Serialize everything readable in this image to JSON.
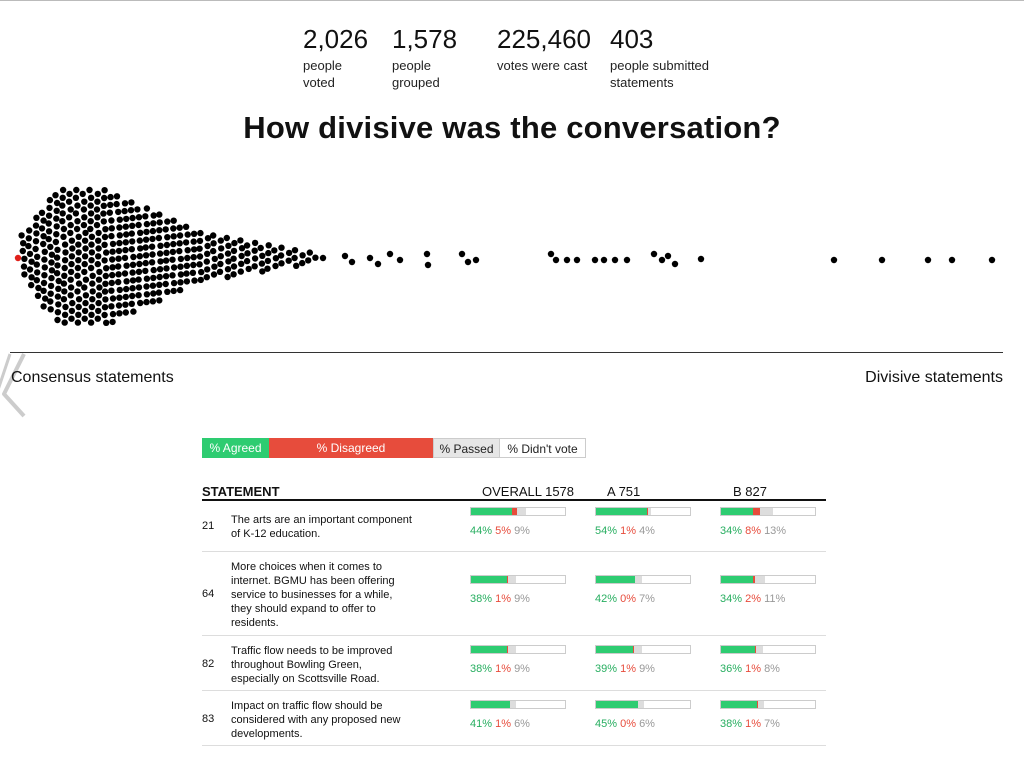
{
  "stats": [
    {
      "number": "2,026",
      "label_lines": [
        "people",
        "voted"
      ]
    },
    {
      "number": "1,578",
      "label_lines": [
        "people",
        "grouped"
      ]
    },
    {
      "number": "225,460",
      "label_lines": [
        "votes were cast",
        ""
      ]
    },
    {
      "number": "403",
      "label_lines": [
        "people submitted",
        "statements"
      ]
    }
  ],
  "title": "How divisive was the conversation?",
  "axis": {
    "left_label": "Consensus statements",
    "right_label": "Divisive statements"
  },
  "legend": {
    "agreed": "% Agreed",
    "disagreed": "% Disagreed",
    "passed": "% Passed",
    "didnt_vote": "% Didn't vote"
  },
  "colors": {
    "agree": "#2ecc71",
    "disagree": "#e74c3c",
    "pass": "#dddddd",
    "dot": "#000000",
    "highlight_dot": "#e0201a"
  },
  "table": {
    "headers": {
      "statement": "STATEMENT",
      "overall": "OVERALL 1578",
      "group_a": "A 751",
      "group_b": "B 827"
    },
    "rows": [
      {
        "id": "21",
        "text_lines": [
          "The arts are an important component",
          "of K-12 education."
        ],
        "overall": {
          "a": 44,
          "d": 5,
          "p": 9,
          "a_label": "44%",
          "d_label": "5%",
          "p_label": "9%"
        },
        "group_a": {
          "a": 54,
          "d": 1,
          "p": 4,
          "a_label": "54%",
          "d_label": "1%",
          "p_label": "4%"
        },
        "group_b": {
          "a": 34,
          "d": 8,
          "p": 13,
          "a_label": "34%",
          "d_label": "8%",
          "p_label": "13%"
        }
      },
      {
        "id": "64",
        "text_lines": [
          "More choices when it comes to",
          "internet. BGMU has been offering",
          "service to businesses for a while,",
          "they should expand to offer to",
          "residents."
        ],
        "overall": {
          "a": 38,
          "d": 1,
          "p": 9,
          "a_label": "38%",
          "d_label": "1%",
          "p_label": "9%"
        },
        "group_a": {
          "a": 42,
          "d": 0,
          "p": 7,
          "a_label": "42%",
          "d_label": "0%",
          "p_label": "7%"
        },
        "group_b": {
          "a": 34,
          "d": 2,
          "p": 11,
          "a_label": "34%",
          "d_label": "2%",
          "p_label": "11%"
        }
      },
      {
        "id": "82",
        "text_lines": [
          "Traffic flow needs to be improved",
          "throughout Bowling Green,",
          "especially on Scottsville Road."
        ],
        "overall": {
          "a": 38,
          "d": 1,
          "p": 9,
          "a_label": "38%",
          "d_label": "1%",
          "p_label": "9%"
        },
        "group_a": {
          "a": 39,
          "d": 1,
          "p": 9,
          "a_label": "39%",
          "d_label": "1%",
          "p_label": "9%"
        },
        "group_b": {
          "a": 36,
          "d": 1,
          "p": 8,
          "a_label": "36%",
          "d_label": "1%",
          "p_label": "8%"
        }
      },
      {
        "id": "83",
        "text_lines": [
          "Impact on traffic flow should be",
          "considered with any proposed new",
          "developments."
        ],
        "overall": {
          "a": 41,
          "d": 1,
          "p": 6,
          "a_label": "41%",
          "d_label": "1%",
          "p_label": "6%"
        },
        "group_a": {
          "a": 45,
          "d": 0,
          "p": 6,
          "a_label": "45%",
          "d_label": "0%",
          "p_label": "6%"
        },
        "group_b": {
          "a": 38,
          "d": 1,
          "p": 7,
          "a_label": "38%",
          "d_label": "1%",
          "p_label": "7%"
        }
      }
    ]
  }
}
